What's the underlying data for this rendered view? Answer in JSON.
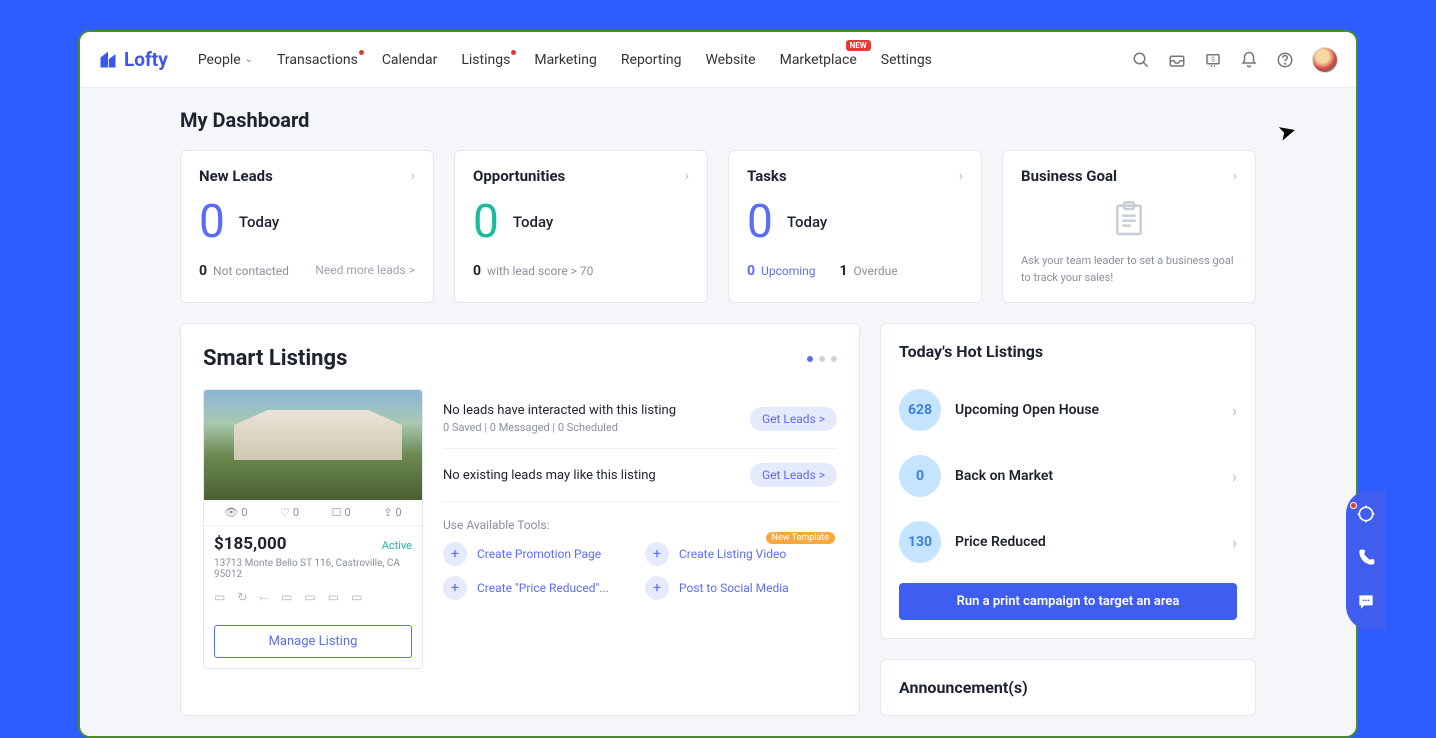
{
  "brand": "Lofty",
  "nav": {
    "items": [
      {
        "label": "People",
        "dropdown": true
      },
      {
        "label": "Transactions",
        "dot": true
      },
      {
        "label": "Calendar"
      },
      {
        "label": "Listings",
        "dot": true
      },
      {
        "label": "Marketing"
      },
      {
        "label": "Reporting"
      },
      {
        "label": "Website"
      },
      {
        "label": "Marketplace",
        "badge": "NEW"
      },
      {
        "label": "Settings"
      }
    ]
  },
  "page_title": "My Dashboard",
  "summary_cards": {
    "new_leads": {
      "title": "New Leads",
      "value": "0",
      "period": "Today",
      "footer_n": "0",
      "footer_text": "Not contacted",
      "cta": "Need more leads >"
    },
    "opportunities": {
      "title": "Opportunities",
      "value": "0",
      "period": "Today",
      "footer_n": "0",
      "footer_text": "with lead score > 70"
    },
    "tasks": {
      "title": "Tasks",
      "value": "0",
      "period": "Today",
      "upcoming_n": "0",
      "upcoming_label": "Upcoming",
      "overdue_n": "1",
      "overdue_label": "Overdue"
    },
    "goal": {
      "title": "Business Goal",
      "text": "Ask your team leader to set a business goal to track your sales!"
    }
  },
  "smart_listings": {
    "title": "Smart Listings",
    "listing": {
      "price": "$185,000",
      "status": "Active",
      "address": "13713 Monte Bello ST 116, Castroville, CA 95012",
      "views": "0",
      "likes": "0",
      "saves": "0",
      "shares": "0",
      "manage_label": "Manage Listing"
    },
    "leads": [
      {
        "line1": "No leads have interacted with this listing",
        "line2": "0 Saved | 0 Messaged | 0 Scheduled",
        "cta": "Get Leads >"
      },
      {
        "line1": "No existing leads may like this listing",
        "line2": "",
        "cta": "Get Leads >"
      }
    ],
    "tools_label": "Use Available Tools:",
    "tools": [
      {
        "label": "Create Promotion Page"
      },
      {
        "label": "Create Listing Video",
        "badge": "New Template"
      },
      {
        "label": "Create \"Price Reduced\"..."
      },
      {
        "label": "Post to Social Media"
      }
    ]
  },
  "hot_listings": {
    "title": "Today's Hot Listings",
    "rows": [
      {
        "count": "628",
        "label": "Upcoming Open House"
      },
      {
        "count": "0",
        "label": "Back on Market"
      },
      {
        "count": "130",
        "label": "Price Reduced"
      }
    ],
    "campaign_cta": "Run a print campaign to target an area"
  },
  "announcements": {
    "title": "Announcement(s)"
  }
}
